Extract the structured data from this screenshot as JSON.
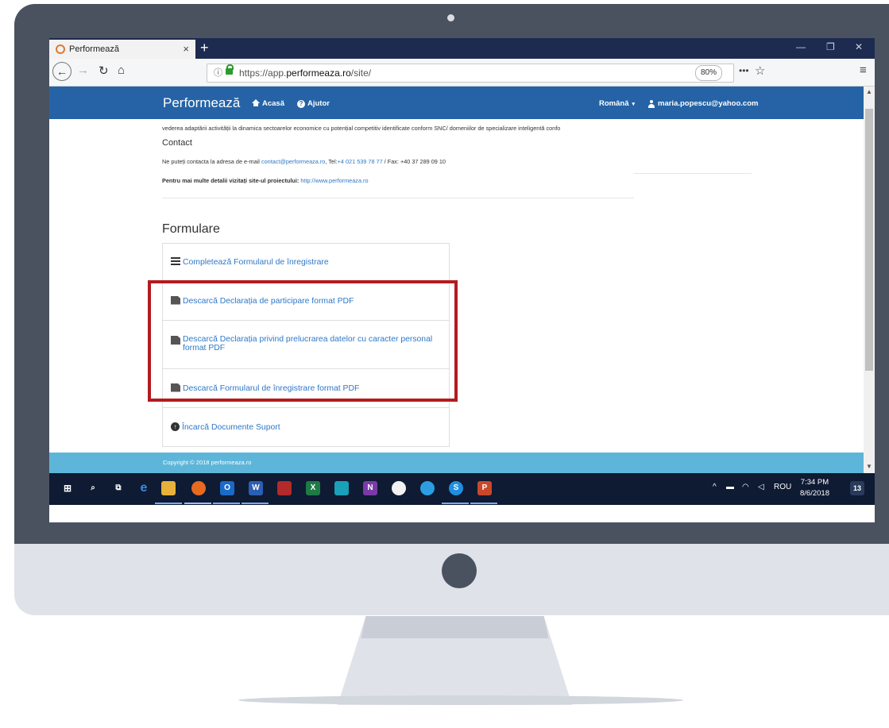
{
  "browser": {
    "tab_title": "Performează",
    "tab_close": "×",
    "new_tab": "+",
    "win_minimize": "—",
    "win_restore": "❐",
    "win_close": "✕",
    "url_prefix": "https://app.",
    "url_domain": "performeaza.ro",
    "url_path": "/site/",
    "zoom": "80%",
    "page_actions": "•••",
    "bookmark": "☆",
    "menu": "≡"
  },
  "site": {
    "brand": "Performează",
    "nav": {
      "home": "Acasă",
      "help": "Ajutor"
    },
    "language": "Română",
    "user_email": "maria.popescu@yahoo.com"
  },
  "content": {
    "intro_line": "vederea adaptării activității la dinamica sectoarelor economice cu potențial competitiv identificate conform SNC/ domeniilor de specializare inteligentă confo",
    "contact_title": "Contact",
    "contact_line_prefix": "Ne puteți contacta la adresa de e-mail ",
    "contact_email": "contact@performeaza.ro",
    "contact_tel_label": ", Tel:",
    "contact_phone": "+4 021 539 78 77",
    "contact_fax": " / Fax: +40 37 289 09 10",
    "details_label": "Pentru mai multe detalii vizitați site-ul proiectului:",
    "details_link": "http://www.performeaza.ro",
    "formulare_title": "Formulare",
    "items": [
      {
        "label": "Completează Formularul de înregistrare"
      },
      {
        "label": "Descarcă Declarația de participare format PDF"
      },
      {
        "label": "Descarcă Declarația privind prelucrarea datelor cu caracter personal format PDF"
      },
      {
        "label": "Descarcă Formularul de înregistrare format PDF"
      },
      {
        "label": "Încarcă Documente Suport"
      }
    ]
  },
  "footer": {
    "copyright": "Copyright © 2018 performeaza.ro"
  },
  "taskbar": {
    "apps": [
      "start-button",
      "search-icon",
      "task-view-icon",
      "edge-icon",
      "file-explorer-icon",
      "firefox-icon",
      "outlook-icon",
      "word-icon",
      "shield-app-icon",
      "excel-icon",
      "whatsapp-icon",
      "onenote-icon",
      "settings-app-icon",
      "telegram-icon",
      "skype-icon",
      "powerpoint-icon"
    ],
    "language": "ROU",
    "time": "7:34 PM",
    "date": "8/6/2018",
    "notifications": "13"
  },
  "colors": {
    "header_blue": "#2563a6",
    "link_blue": "#2f78c7",
    "footer_band": "#5db6d9",
    "highlight_red": "#b31b20",
    "taskbar": "#0e1b33"
  }
}
